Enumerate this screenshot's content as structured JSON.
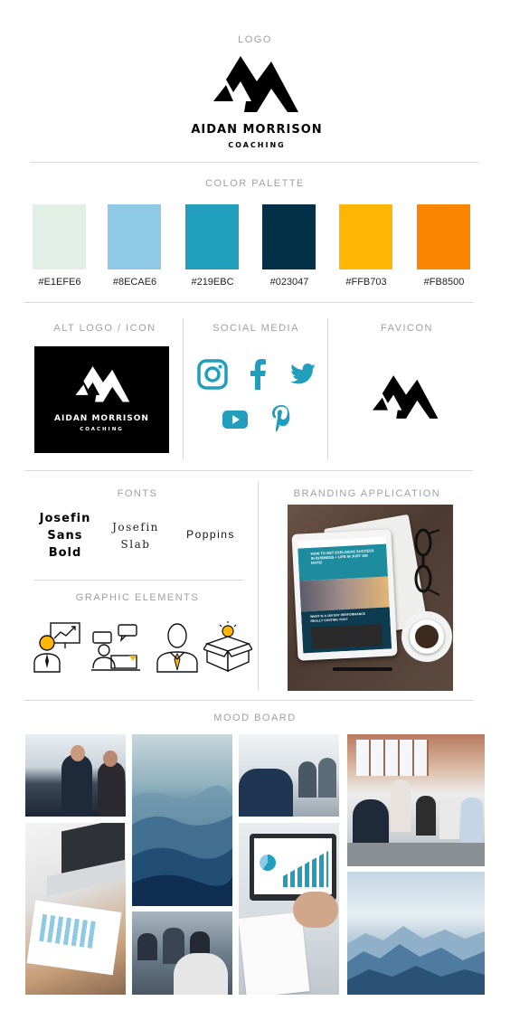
{
  "logo": {
    "section_title": "LOGO",
    "brand_name": "AIDAN MORRISON",
    "brand_sub": "COACHING"
  },
  "palette": {
    "section_title": "COLOR PALETTE",
    "colors": [
      {
        "hex": "#E1EFE6"
      },
      {
        "hex": "#8ECAE6"
      },
      {
        "hex": "#219EBC"
      },
      {
        "hex": "#023047"
      },
      {
        "hex": "#FFB703"
      },
      {
        "hex": "#FB8500"
      }
    ]
  },
  "alt_logo": {
    "section_title": "ALT LOGO / ICON",
    "brand_name": "AIDAN MORRISON",
    "brand_sub": "COACHING"
  },
  "social": {
    "section_title": "SOCIAL MEDIA",
    "icons": [
      "instagram-icon",
      "facebook-icon",
      "twitter-icon",
      "youtube-icon",
      "pinterest-icon"
    ],
    "color": "#219EBC"
  },
  "favicon": {
    "section_title": "FAVICON"
  },
  "fonts": {
    "section_title": "FONTS",
    "samples": [
      {
        "line1": "Josefin",
        "line2": "Sans",
        "line3": "Bold"
      },
      {
        "line1": "Josefin",
        "line2": "Slab"
      },
      {
        "line1": "Poppins"
      }
    ]
  },
  "graphics": {
    "section_title": "GRAPHIC ELEMENTS",
    "icons": [
      "presenter-chart-icon",
      "meeting-icon",
      "businessman-icon",
      "idea-box-icon"
    ],
    "accent": "#FFB703"
  },
  "branding": {
    "section_title": "BRANDING APPLICATION",
    "tablet_headline": "HOW TO GET EXPLOSIVE SUCCESS IN BUSINESS + LIFE IN JUST 180 DAYS!",
    "tablet_sub": "WHAT IS A 180 DAY PERFORMANCE",
    "tablet_sub2": "REALLY COSTING YOU?"
  },
  "mood": {
    "section_title": "MOOD BOARD"
  }
}
